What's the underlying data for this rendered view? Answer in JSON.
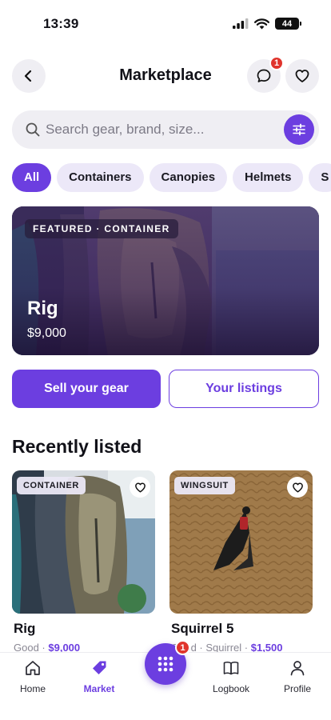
{
  "status_bar": {
    "time": "13:39",
    "battery": "44"
  },
  "header": {
    "title": "Marketplace",
    "chat_badge": "1"
  },
  "search": {
    "placeholder": "Search gear, brand, size...",
    "value": ""
  },
  "chips": [
    "All",
    "Containers",
    "Canopies",
    "Helmets",
    "S"
  ],
  "featured": {
    "tag": "FEATURED · CONTAINER",
    "title": "Rig",
    "price": "$9,000"
  },
  "actions": {
    "sell_label": "Sell your gear",
    "listings_label": "Your listings"
  },
  "recent": {
    "title": "Recently listed",
    "items": [
      {
        "tag": "CONTAINER",
        "title": "Rig",
        "condition": "Good",
        "brand": "",
        "price": "$9,000"
      },
      {
        "tag": "WINGSUIT",
        "title": "Squirrel 5",
        "condition": "Good",
        "brand": "Squirrel",
        "price": "$1,500"
      }
    ]
  },
  "nav": {
    "home": "Home",
    "market": "Market",
    "logbook": "Logbook",
    "profile": "Profile",
    "fab_badge": "1"
  },
  "colors": {
    "accent": "#6c3ee0",
    "chip_bg": "#ece8f8",
    "badge": "#e0342c",
    "surface": "#efeef3"
  }
}
